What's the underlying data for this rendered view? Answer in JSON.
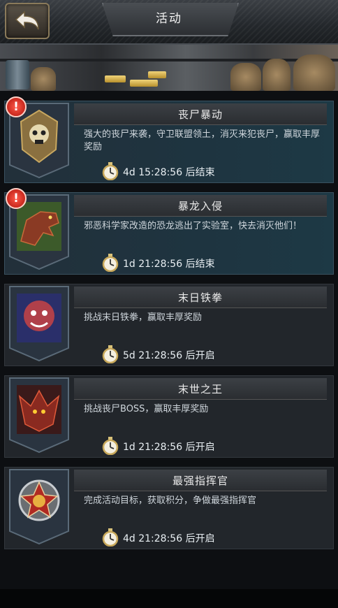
{
  "header": {
    "title": "活动",
    "back_icon": "back-arrow-icon"
  },
  "events": [
    {
      "name": "丧尸暴动",
      "desc": "强大的丧尸来袭，守卫联盟领土，消灭来犯丧尸，赢取丰厚奖励",
      "time": "4d 15:28:56 后结束",
      "icon": "skull-emblem-icon",
      "alert": "!",
      "active": true
    },
    {
      "name": "暴龙入侵",
      "desc": "邪恶科学家改造的恐龙逃出了实验室，快去消灭他们！",
      "time": "1d 21:28:56 后结束",
      "icon": "dinosaur-icon",
      "alert": "!",
      "active": true
    },
    {
      "name": "末日铁拳",
      "desc": "挑战末日铁拳，赢取丰厚奖励",
      "time": "5d 21:28:56 后开启",
      "icon": "mutant-boss-icon",
      "alert": "",
      "active": false
    },
    {
      "name": "末世之王",
      "desc": "挑战丧尸BOSS，赢取丰厚奖励",
      "time": "1d 21:28:56 后开启",
      "icon": "dragon-king-icon",
      "alert": "",
      "active": false
    },
    {
      "name": "最强指挥官",
      "desc": "完成活动目标，获取积分，争做最强指挥官",
      "time": "4d 21:28:56 后开启",
      "icon": "commander-medal-icon",
      "alert": "",
      "active": false
    }
  ],
  "colors": {
    "active_bg": "#1d3945",
    "inactive_bg": "#22262b",
    "alert": "#d41f12",
    "gold": "#e8c060"
  }
}
